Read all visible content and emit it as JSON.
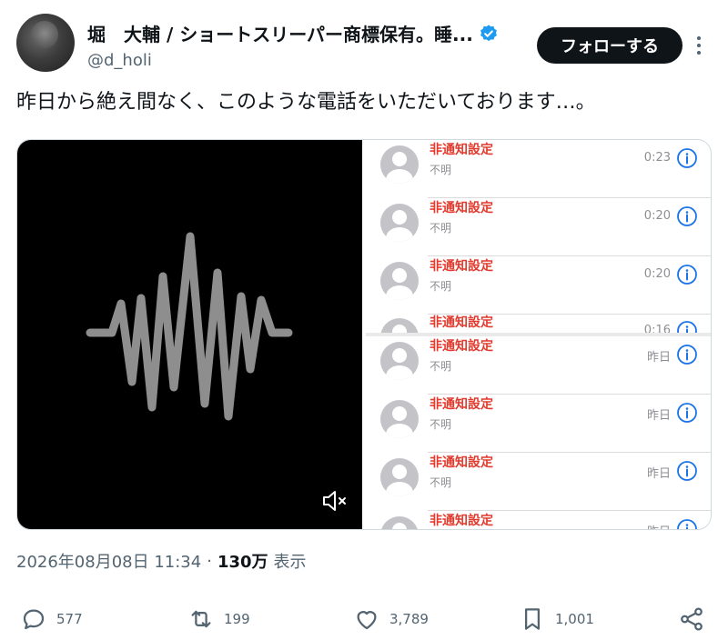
{
  "author": {
    "display_name": "堀　大輔 / ショートスリーパー商標保有。睡...",
    "handle": "@d_holi",
    "verified": true
  },
  "follow_label": "フォローする",
  "tweet": {
    "text": "昨日から絶え間なく、このような電話をいただいております…。"
  },
  "calls_top": [
    {
      "title": "非通知設定",
      "sub": "不明",
      "time": "0:23"
    },
    {
      "title": "非通知設定",
      "sub": "不明",
      "time": "0:20"
    },
    {
      "title": "非通知設定",
      "sub": "不明",
      "time": "0:20"
    },
    {
      "title": "非通知設定",
      "sub": "",
      "time": "0:16"
    }
  ],
  "calls_bottom": [
    {
      "title": "非通知設定",
      "sub": "不明",
      "time": "昨日"
    },
    {
      "title": "非通知設定",
      "sub": "不明",
      "time": "昨日"
    },
    {
      "title": "非通知設定",
      "sub": "不明",
      "time": "昨日"
    },
    {
      "title": "非通知設定",
      "sub": "",
      "time": "昨日"
    }
  ],
  "meta": {
    "timestamp": "2026年08月08日 11:34",
    "separator": "·",
    "views": "130万",
    "views_label": "表示"
  },
  "actions": {
    "replies": "577",
    "reposts": "199",
    "likes": "3,789",
    "bookmarks": "1,001"
  },
  "colors": {
    "verified": "#1d9bf0",
    "call_title": "#e23b2e",
    "info_icon": "#1a73e8",
    "wave": "#8e8e8e"
  }
}
